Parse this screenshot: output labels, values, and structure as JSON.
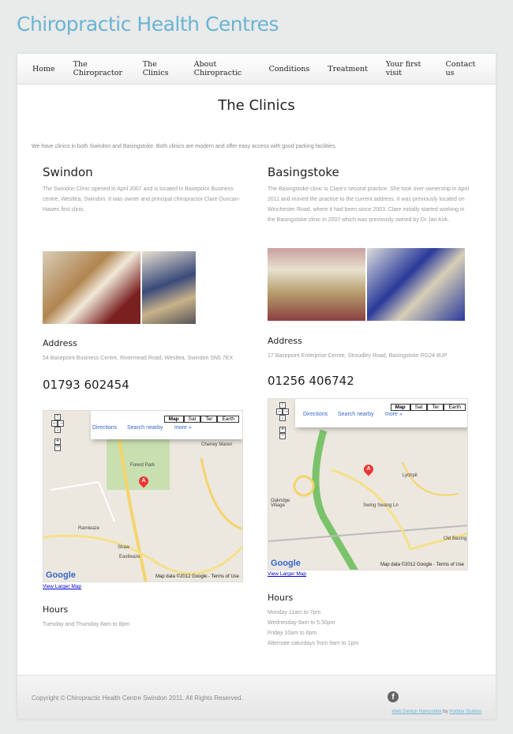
{
  "site_title": "Chiropractic Health Centres",
  "nav": [
    "Home",
    "The Chiropractor",
    "The Clinics",
    "About Chiropractic",
    "Conditions",
    "Treatment",
    "Your first visit",
    "Contact us"
  ],
  "page_title": "The Clinics",
  "intro": "We have clinics in both Swindon and Basingstoke. Both clinics are modern and offer easy access with good parking facilities.",
  "swindon": {
    "name": "Swindon",
    "description": "The Swindon Clinic opened in April 2007 and is located in Basepoint Business centre, Westlea, Swindon. It was owner and principal chiropractor Clare Duncan-Hawes first clinic.",
    "address_heading": "Address",
    "address": "54 Basepoint Business Centre, Rivermead Road, Westlea, Swindon SN5 7EX",
    "phone": "01793 602454",
    "map_places": [
      "Forest Park",
      "Cheney Manor",
      "Ramleaze",
      "Shaw",
      "Eastleaze"
    ],
    "view_larger": "View Larger Map",
    "hours_heading": "Hours",
    "hours": [
      "Tuesday and Thursday 8am to 8pm"
    ]
  },
  "basingstoke": {
    "name": "Basingstoke",
    "description": "The Basingstoke clinic is Clare's second practice. She took over ownership in April 2011 and moved the practice to the current address. It was previously located on Winchester Road, where it had been since 2003. Clare initially started working in the Basingstoke clinic in 2007 which was previously owned by Dr Jan Kirk.",
    "address_heading": "Address",
    "address": "17 Basepoint Enterprise Centre, Stroudley Road, Basingstoke RG24 8UP",
    "phone": "01256 406742",
    "map_places": [
      "Oakridge Village",
      "Lychpit",
      "Swing Swang Ln",
      "Old Basing"
    ],
    "view_larger": "View Larger Map",
    "hours_heading": "Hours",
    "hours": [
      "Monday 11am to 7pm",
      "Wednesday 9am to 5.30pm",
      "Friday 10am to 6pm",
      "Alternate saturdays from 9am to 1pm"
    ]
  },
  "map_ui": {
    "directions": "Directions",
    "search_nearby": "Search nearby",
    "more": "more »",
    "types": [
      "Map",
      "Sat",
      "Ter",
      "Earth"
    ],
    "marker": "A",
    "logo": "Google",
    "copyright": "Map data ©2012 Google - Terms of Use"
  },
  "footer": {
    "copyright": "Copyright © Chiropractic Health Centre Swindon 2011. All Rights Reserved.",
    "facebook": "f",
    "credit_link1": "Web Design Hampshire",
    "credit_by": "by",
    "credit_link2": "Hotbox Studios"
  },
  "colors": {
    "accent": "#6ab4d4"
  }
}
